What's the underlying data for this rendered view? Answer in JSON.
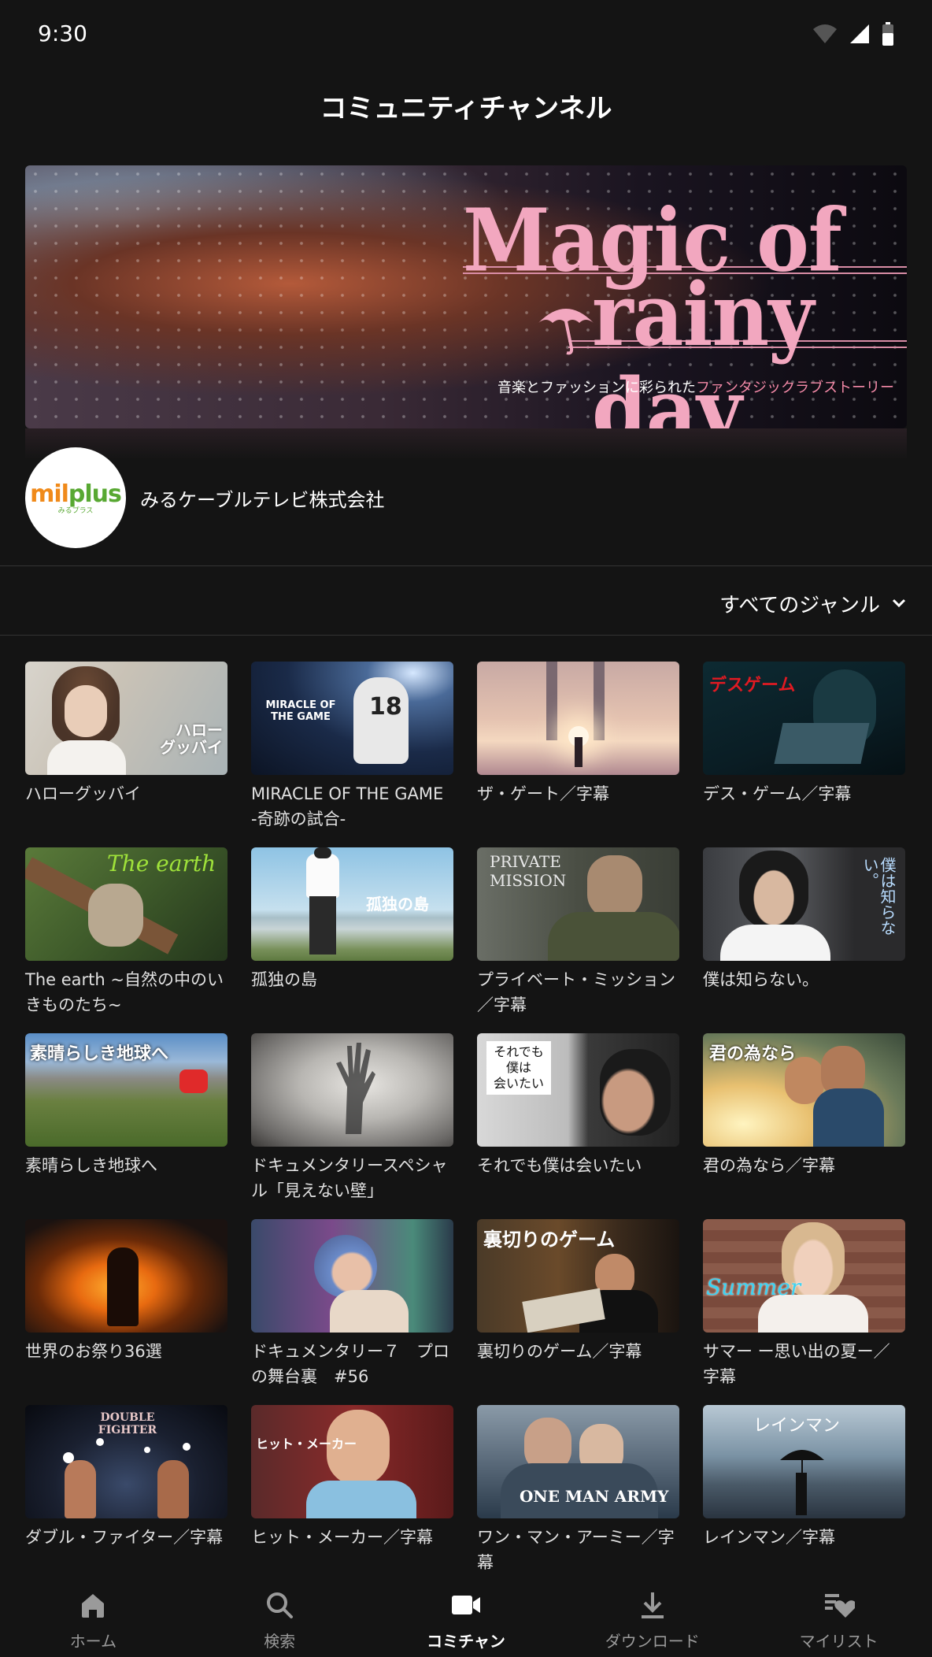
{
  "status": {
    "time": "9:30"
  },
  "header": {
    "title": "コミュニティチャンネル"
  },
  "banner": {
    "title_line1": "Magic of",
    "title_line2": "rainy day",
    "subtitle_plain": "音楽とファッションに彩られた",
    "subtitle_accent": "ファンタジックラブストーリー",
    "accent_color": "#f2a7bf"
  },
  "channel": {
    "logo_mil": "mil",
    "logo_plus": "plus",
    "logo_sub": "みるプラス",
    "name": "みるケーブルテレビ株式会社"
  },
  "genre": {
    "label": "すべてのジャンル"
  },
  "items": [
    {
      "title": "ハローグッバイ",
      "overlay": "ハロー\nグッバイ"
    },
    {
      "title": "MIRACLE OF THE GAME -奇跡の試合-",
      "overlay": "MIRACLE OF THE GAME"
    },
    {
      "title": "ザ・ゲート／字幕",
      "overlay": ""
    },
    {
      "title": "デス・ゲーム／字幕",
      "overlay": "デスゲーム"
    },
    {
      "title": "The earth ~自然の中のいきものたち~",
      "overlay": "The earth"
    },
    {
      "title": "孤独の島",
      "overlay": "孤独の島"
    },
    {
      "title": "プライベート・ミッション／字幕",
      "overlay": "PRIVATE MISSION"
    },
    {
      "title": "僕は知らない。",
      "overlay": "僕は知らない。"
    },
    {
      "title": "素晴らしき地球へ",
      "overlay": "素晴らしき地球へ"
    },
    {
      "title": "ドキュメンタリースペシャル「見えない壁」",
      "overlay": ""
    },
    {
      "title": "それでも僕は会いたい",
      "overlay": "それでも\n僕は\n会いたい"
    },
    {
      "title": "君の為なら／字幕",
      "overlay": "君の為なら"
    },
    {
      "title": "世界のお祭り36選",
      "overlay": ""
    },
    {
      "title": "ドキュメンタリー７　プロの舞台裏　#56",
      "overlay": ""
    },
    {
      "title": "裏切りのゲーム／字幕",
      "overlay": "裏切りのゲーム"
    },
    {
      "title": "サマー ー思い出の夏ー／字幕",
      "overlay": "Summer"
    },
    {
      "title": "ダブル・ファイター／字幕",
      "overlay": "DOUBLE FIGHTER"
    },
    {
      "title": "ヒット・メーカー／字幕",
      "overlay": "ヒット・メーカー"
    },
    {
      "title": "ワン・マン・アーミー／字幕",
      "overlay": "ONE MAN ARMY"
    },
    {
      "title": "レインマン／字幕",
      "overlay": "レインマン"
    }
  ],
  "nav": [
    {
      "label": "ホーム",
      "icon": "home-icon"
    },
    {
      "label": "検索",
      "icon": "search-icon"
    },
    {
      "label": "コミチャン",
      "icon": "video-camera-icon",
      "active": true
    },
    {
      "label": "ダウンロード",
      "icon": "download-icon"
    },
    {
      "label": "マイリスト",
      "icon": "mylist-heart-icon"
    }
  ]
}
